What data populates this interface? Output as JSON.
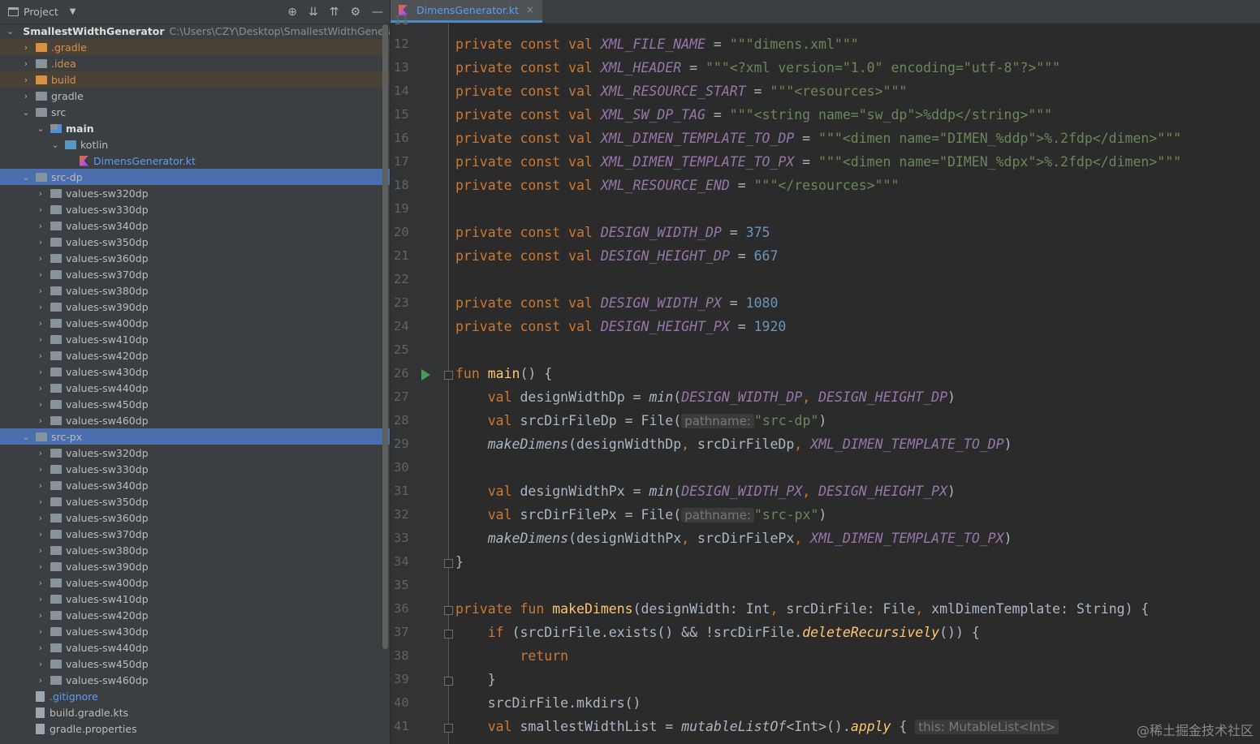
{
  "sidebar": {
    "title": "Project",
    "root_name": "SmallestWidthGenerator",
    "root_path": "C:\\Users\\CZY\\Desktop\\SmallestWidthGenerat",
    "items": {
      "gradle_hidden": ".gradle",
      "idea": ".idea",
      "build": "build",
      "gradle": "gradle",
      "src": "src",
      "main": "main",
      "kotlin": "kotlin",
      "kt_file": "DimensGenerator.kt",
      "src_dp": "src-dp",
      "src_px": "src-px",
      "gitignore": ".gitignore",
      "build_gradle": "build.gradle.kts",
      "gradle_props": "gradle.properties"
    },
    "values_folders": [
      "values-sw320dp",
      "values-sw330dp",
      "values-sw340dp",
      "values-sw350dp",
      "values-sw360dp",
      "values-sw370dp",
      "values-sw380dp",
      "values-sw390dp",
      "values-sw400dp",
      "values-sw410dp",
      "values-sw420dp",
      "values-sw430dp",
      "values-sw440dp",
      "values-sw450dp",
      "values-sw460dp"
    ]
  },
  "editor": {
    "tab_label": "DimensGenerator.kt",
    "hint_pathname": "pathname:",
    "hint_this": "this: MutableList<Int>"
  },
  "watermark": "@稀土掘金技术社区"
}
